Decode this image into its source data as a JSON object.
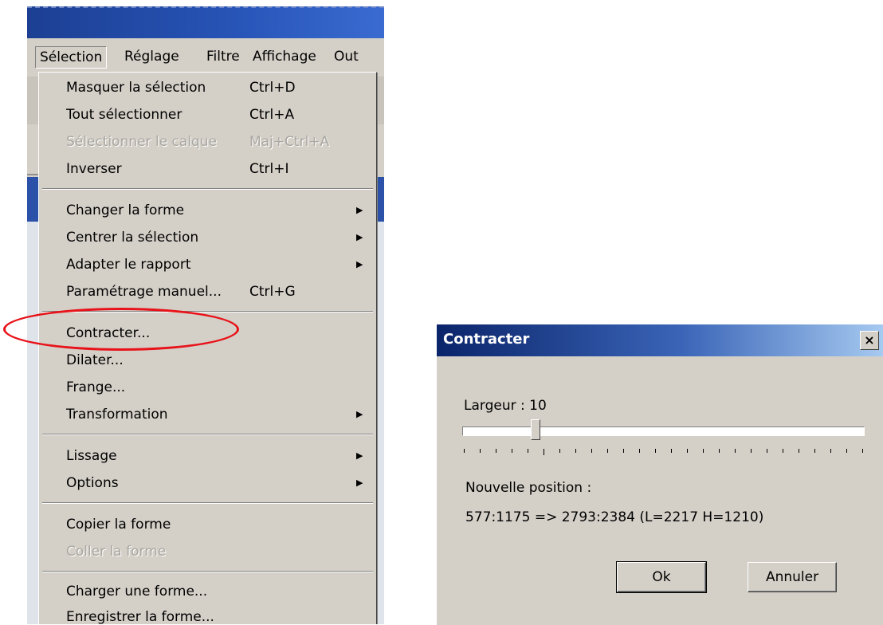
{
  "menubar": {
    "items": [
      "Sélection",
      "Réglage",
      "Filtre",
      "Affichage",
      "Out"
    ]
  },
  "menu": {
    "items": [
      {
        "label": "Masquer la sélection",
        "shortcut": "Ctrl+D"
      },
      {
        "label": "Tout sélectionner",
        "shortcut": "Ctrl+A"
      },
      {
        "label": "Sélectionner le calque",
        "shortcut": "Maj+Ctrl+A"
      },
      {
        "label": "Inverser",
        "shortcut": "Ctrl+I"
      },
      {
        "label": "Changer la forme",
        "shortcut": ""
      },
      {
        "label": "Centrer la sélection",
        "shortcut": ""
      },
      {
        "label": "Adapter le rapport",
        "shortcut": ""
      },
      {
        "label": "Paramétrage manuel...",
        "shortcut": "Ctrl+G"
      },
      {
        "label": "Contracter...",
        "shortcut": ""
      },
      {
        "label": "Dilater...",
        "shortcut": ""
      },
      {
        "label": "Frange...",
        "shortcut": ""
      },
      {
        "label": "Transformation",
        "shortcut": ""
      },
      {
        "label": "Lissage",
        "shortcut": ""
      },
      {
        "label": "Options",
        "shortcut": ""
      },
      {
        "label": "Copier la forme",
        "shortcut": ""
      },
      {
        "label": "Coller la forme",
        "shortcut": ""
      },
      {
        "label": "Charger une forme...",
        "shortcut": ""
      },
      {
        "label": "Enregistrer la forme...",
        "shortcut": ""
      }
    ]
  },
  "dialog": {
    "title": "Contracter",
    "close_glyph": "×",
    "width_label": "Largeur : 10",
    "slider_value": 10,
    "new_position_label": "Nouvelle position :",
    "position_value": "577:1175 => 2793:2384 (L=2217  H=1210)",
    "ok_label": "Ok",
    "cancel_label": "Annuler"
  },
  "colors": {
    "highlight_ellipse": "#e8131a",
    "dialog_title_start": "#0a246a",
    "dialog_title_end": "#a6caf0"
  }
}
